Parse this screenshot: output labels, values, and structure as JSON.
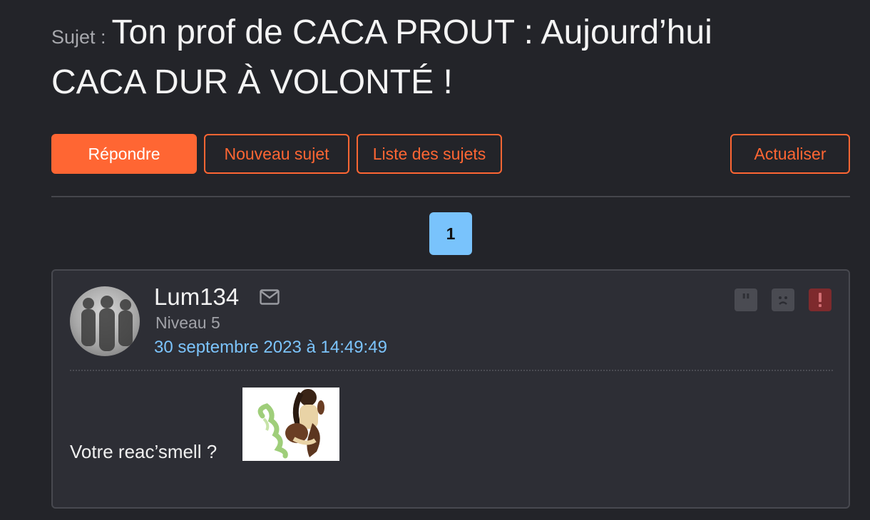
{
  "topic": {
    "prefix": "Sujet :",
    "title": "Ton prof de CACA PROUT : Aujourd’hui CACA DUR À VOLONTÉ !"
  },
  "toolbar": {
    "reply_label": "Répondre",
    "new_topic_label": "Nouveau sujet",
    "topic_list_label": "Liste des sujets",
    "refresh_label": "Actualiser"
  },
  "pagination": {
    "current_page": "1"
  },
  "post": {
    "author": "Lum134",
    "level": "Niveau 5",
    "date": "30 septembre 2023 à 14:49:49",
    "text": "Votre reac’smell ?",
    "icons": [
      "mail-icon",
      "quote-icon",
      "sad-face-icon",
      "report-icon"
    ]
  },
  "colors": {
    "background": "#232429",
    "accent": "#ff6633",
    "link": "#7cc4fc",
    "page_active": "#79c3fc",
    "post_bg": "#2d2e35",
    "report": "#7e2a2d"
  }
}
